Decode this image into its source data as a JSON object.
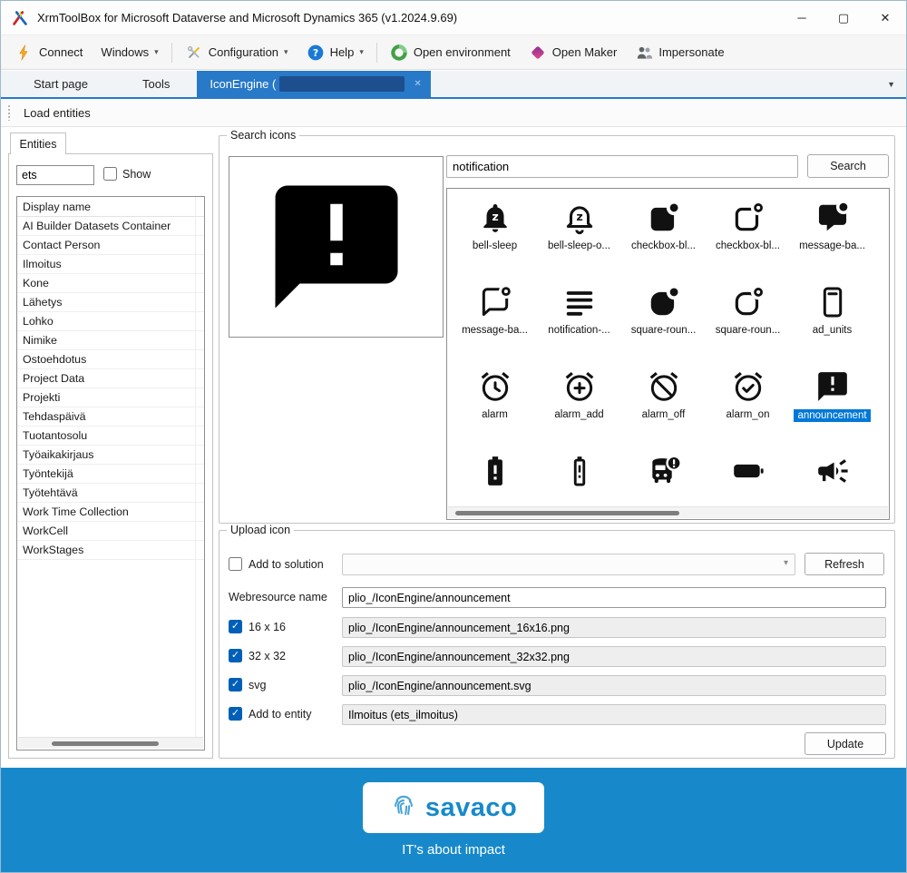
{
  "window": {
    "title": "XrmToolBox for Microsoft Dataverse and Microsoft Dynamics 365 (v1.2024.9.69)",
    "minimize_glyph": "─",
    "maximize_glyph": "▢",
    "close_glyph": "✕"
  },
  "toolbar": {
    "group1": [
      {
        "label": "Connect",
        "icon": "lightning"
      },
      {
        "label": "Windows",
        "caret": true
      }
    ],
    "group2": [
      {
        "label": "Configuration",
        "icon": "config",
        "caret": true
      },
      {
        "label": "Help",
        "icon": "help",
        "caret": true
      }
    ],
    "group3": [
      {
        "label": "Open environment",
        "icon": "env"
      },
      {
        "label": "Open Maker",
        "icon": "maker"
      },
      {
        "label": "Impersonate",
        "icon": "impersonate"
      }
    ]
  },
  "tabs": {
    "start": "Start page",
    "tools": "Tools",
    "active_prefix": "IconEngine (",
    "close_glyph": "✕",
    "overflow_glyph": "▼"
  },
  "actionbar": {
    "load_entities": "Load entities"
  },
  "entities": {
    "tab_label": "Entities",
    "filter_value": "ets",
    "show_label": "Show",
    "header": "Display name",
    "items": [
      "AI Builder Datasets Container",
      "Contact Person",
      "Ilmoitus",
      "Kone",
      "Lähetys",
      "Lohko",
      "Nimike",
      "Ostoehdotus",
      "Project Data",
      "Projekti",
      "Tehdaspäivä",
      "Tuotantosolu",
      "Työaikakirjaus",
      "Työntekijä",
      "Työtehtävä",
      "Work Time Collection",
      "WorkCell",
      "WorkStages"
    ]
  },
  "search_icons": {
    "group_label": "Search icons",
    "preview_icon": "announcement",
    "search_value": "notification",
    "search_button": "Search",
    "icons": [
      {
        "label": "bell-sleep",
        "icon": "bell-sleep-f"
      },
      {
        "label": "bell-sleep-o...",
        "icon": "bell-sleep-o"
      },
      {
        "label": "checkbox-bl...",
        "icon": "badge-box-f"
      },
      {
        "label": "checkbox-bl...",
        "icon": "badge-box-o"
      },
      {
        "label": "message-ba...",
        "icon": "msg-badge-f"
      },
      {
        "label": "message-ba...",
        "icon": "msg-badge-o"
      },
      {
        "label": "notification-...",
        "icon": "notif-lines"
      },
      {
        "label": "square-roun...",
        "icon": "round-badge-f"
      },
      {
        "label": "square-roun...",
        "icon": "round-badge-o"
      },
      {
        "label": "ad_units",
        "icon": "ad-units"
      },
      {
        "label": "alarm",
        "icon": "alarm"
      },
      {
        "label": "alarm_add",
        "icon": "alarm-add"
      },
      {
        "label": "alarm_off",
        "icon": "alarm-off"
      },
      {
        "label": "alarm_on",
        "icon": "alarm-on"
      },
      {
        "label": "announcement",
        "icon": "announcement",
        "selected": true
      },
      {
        "label": "",
        "icon": "battery-alert-f"
      },
      {
        "label": "",
        "icon": "battery-alert-o"
      },
      {
        "label": "",
        "icon": "bus-alert"
      },
      {
        "label": "",
        "icon": "battery-horiz"
      },
      {
        "label": "",
        "icon": "campaign"
      }
    ]
  },
  "upload": {
    "group_label": "Upload icon",
    "add_to_solution_label": "Add to solution",
    "refresh_button": "Refresh",
    "webresource_label": "Webresource name",
    "webresource_value": "plio_/IconEngine/announcement",
    "rows": [
      {
        "label": "16 x 16",
        "checked": true,
        "value": "plio_/IconEngine/announcement_16x16.png"
      },
      {
        "label": "32 x 32",
        "checked": true,
        "value": "plio_/IconEngine/announcement_32x32.png"
      },
      {
        "label": "svg",
        "checked": true,
        "value": "plio_/IconEngine/announcement.svg"
      },
      {
        "label": "Add to entity",
        "checked": true,
        "value": "Ilmoitus (ets_ilmoitus)"
      }
    ],
    "update_button": "Update"
  },
  "footer": {
    "brand": "savaco",
    "tagline": "IT's about impact"
  },
  "colors": {
    "accent": "#2879c8",
    "footer_blue": "#1789ca",
    "selection": "#0078d7",
    "checkbox": "#005fb8"
  }
}
